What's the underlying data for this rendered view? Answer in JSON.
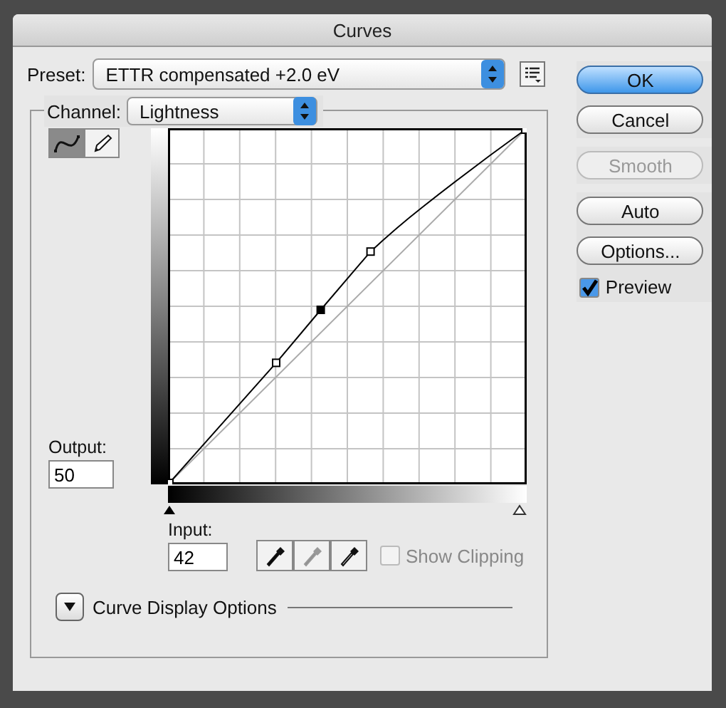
{
  "window": {
    "title": "Curves"
  },
  "preset": {
    "label": "Preset:",
    "value": "ETTR compensated +2.0 eV"
  },
  "channel": {
    "label": "Channel:",
    "value": "Lightness"
  },
  "tools": [
    {
      "kind": "curve",
      "selected": true
    },
    {
      "kind": "pencil",
      "selected": false
    }
  ],
  "output": {
    "label": "Output:",
    "value": "50"
  },
  "input": {
    "label": "Input:",
    "value": "42"
  },
  "eyedroppers": [
    {
      "kind": "black",
      "disabled": false
    },
    {
      "kind": "gray",
      "disabled": true
    },
    {
      "kind": "white",
      "disabled": false
    }
  ],
  "show_clipping": {
    "label": "Show Clipping",
    "checked": false,
    "disabled": true
  },
  "curve_display_options": {
    "label": "Curve Display Options",
    "expanded": false
  },
  "buttons": [
    {
      "label": "OK",
      "default": true,
      "disabled": false
    },
    {
      "label": "Cancel",
      "default": false,
      "disabled": false
    },
    {
      "label": "Smooth",
      "default": false,
      "disabled": true
    },
    {
      "label": "Auto",
      "default": false,
      "disabled": false
    },
    {
      "label": "Options...",
      "default": false,
      "disabled": false
    }
  ],
  "preview": {
    "label": "Preview",
    "checked": true
  }
}
